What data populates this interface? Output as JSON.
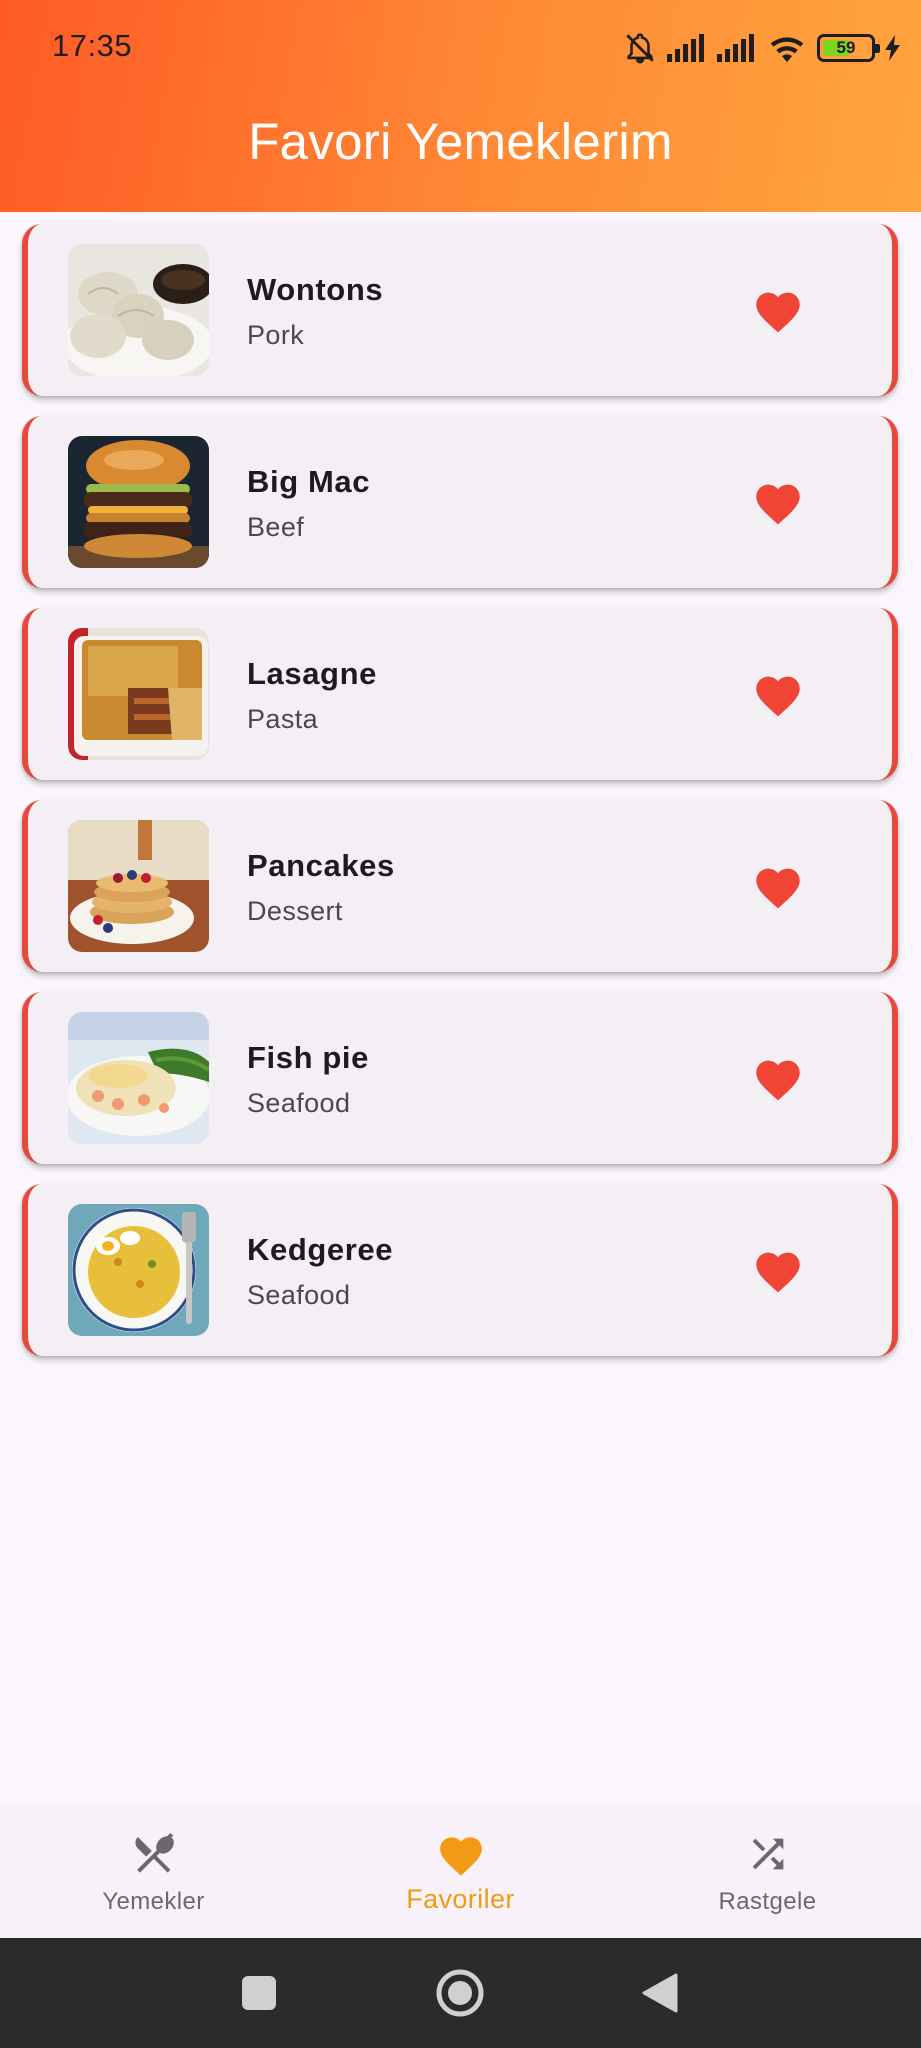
{
  "status_bar": {
    "time": "17:35",
    "battery": "59",
    "battery_level": 0.59,
    "icons": [
      "bell-off-icon",
      "signal-icon",
      "signal-icon",
      "wifi-icon",
      "battery-icon",
      "charging-icon"
    ]
  },
  "header": {
    "title": "Favori Yemeklerim"
  },
  "meals": [
    {
      "name": "Wontons",
      "category": "Pork",
      "favorite": true
    },
    {
      "name": "Big Mac",
      "category": "Beef",
      "favorite": true
    },
    {
      "name": "Lasagne",
      "category": "Pasta",
      "favorite": true
    },
    {
      "name": "Pancakes",
      "category": "Dessert",
      "favorite": true
    },
    {
      "name": "Fish pie",
      "category": "Seafood",
      "favorite": true
    },
    {
      "name": "Kedgeree",
      "category": "Seafood",
      "favorite": true
    }
  ],
  "bottom_nav": {
    "items": [
      {
        "label": "Yemekler",
        "icon": "fork-knife-icon",
        "active": false
      },
      {
        "label": "Favoriler",
        "icon": "heart-icon",
        "active": true
      },
      {
        "label": "Rastgele",
        "icon": "shuffle-icon",
        "active": false
      }
    ]
  },
  "colors": {
    "header_start": "#ff5a26",
    "header_end": "#ffa53f",
    "accent_red": "#e7483b",
    "heart": "#f04434",
    "active_nav": "#f19b15",
    "card_bg": "#f4eff5"
  }
}
